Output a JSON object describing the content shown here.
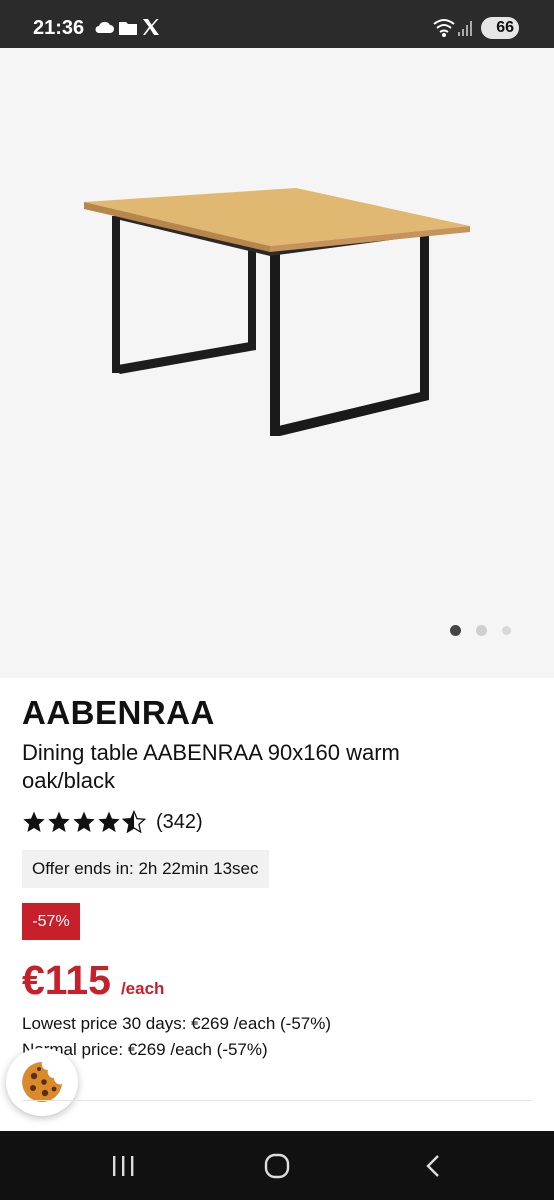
{
  "status_bar": {
    "time": "21:36",
    "battery": "66",
    "icons": [
      "cloud-icon",
      "folder-icon",
      "x-logo-icon",
      "wifi-icon",
      "signal-icon"
    ]
  },
  "gallery": {
    "image_alt": "Dining table warm oak/black",
    "dots": 3,
    "active_dot": 0
  },
  "product": {
    "brand": "AABENRAA",
    "name": "Dining table AABENRAA 90x160 warm oak/black",
    "rating": 4.5,
    "review_count": "(342)",
    "offer": "Offer ends in: 2h 22min 13sec",
    "discount": "-57%",
    "price": "€115",
    "price_unit": "/each",
    "lowest_price": "Lowest price 30 days: €269 /each (-57%)",
    "normal_price": "Normal price: €269 /each (-57%)"
  },
  "colors": {
    "accent": "#c8202a",
    "status_bar": "#2b2b2b",
    "nav_bar": "#111111",
    "image_bg": "#f5f5f5"
  },
  "nav": {
    "icons": [
      "recent-apps-icon",
      "home-icon",
      "back-icon"
    ]
  }
}
